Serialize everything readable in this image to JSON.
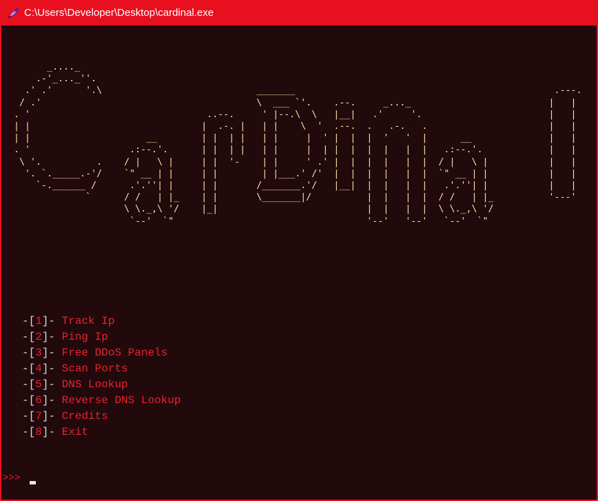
{
  "window": {
    "title": "C:\\Users\\Developer\\Desktop\\cardinal.exe",
    "icon": "python-feather-icon",
    "accent_color": "#e8101f",
    "background_color": "#22090c"
  },
  "banner": {
    "ascii_art": "        _...._\n      .-'_..._''.\n    .' .'      '.\\\n   / .'\n  . '\n  | |\n  | |\n  . '\n   \\ '.          .\n    '. `._____.-'/\n      `-.______ /\n               `",
    "text_color": "#f7e3a6"
  },
  "menu": {
    "items": [
      {
        "open": "-[",
        "number": "1",
        "close": "]-",
        "label": "Track Ip"
      },
      {
        "open": "-[",
        "number": "2",
        "close": "]-",
        "label": "Ping Ip"
      },
      {
        "open": "-[",
        "number": "3",
        "close": "]-",
        "label": "Free DDoS Panels"
      },
      {
        "open": "-[",
        "number": "4",
        "close": "]-",
        "label": "Scan Ports"
      },
      {
        "open": "-[",
        "number": "5",
        "close": "]-",
        "label": "DNS Lookup"
      },
      {
        "open": "-[",
        "number": "6",
        "close": "]-",
        "label": "Reverse DNS Lookup"
      },
      {
        "open": "-[",
        "number": "7",
        "close": "]-",
        "label": "Credits"
      },
      {
        "open": "-[",
        "number": "8",
        "close": "]-",
        "label": "Exit"
      }
    ],
    "label_color": "#e8242e",
    "bracket_color": "#d8d8d8"
  },
  "prompt": {
    "text": ">>>"
  }
}
